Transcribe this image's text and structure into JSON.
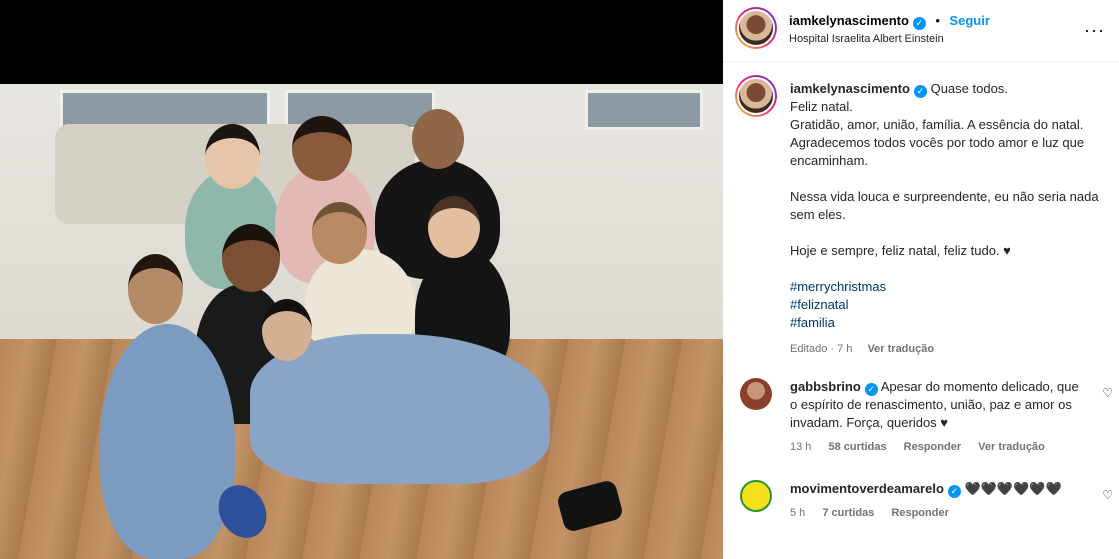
{
  "post": {
    "username": "iamkelynascimento",
    "follow_label": "Seguir",
    "separator": "•",
    "location": "Hospital Israelita Albert Einstein",
    "more_label": "···"
  },
  "caption": {
    "username": "iamkelynascimento",
    "lines": [
      "Quase todos.",
      "Feliz natal.",
      "Gratidão, amor, união, família. A essência do natal. Agradecemos todos vocês por todo amor e luz que encaminham.",
      "Nessa vida louca e surpreendente, eu não seria nada sem eles.",
      "Hoje e sempre, feliz natal, feliz tudo. ♥"
    ],
    "hashtags": [
      "#merrychristmas",
      "#feliznatal",
      "#familia"
    ],
    "edited": "Editado · 7 h",
    "translate": "Ver tradução"
  },
  "comments": [
    {
      "username": "gabbsbrino",
      "text": "Apesar do momento delicado, que o espírito de renascimento, união, paz e amor os invadam. Força, queridos ♥",
      "time": "13 h",
      "likes": "58 curtidas",
      "reply": "Responder",
      "translate": "Ver tradução"
    },
    {
      "username": "movimentoverdeamarelo",
      "text": "🖤🖤🖤🖤🖤🖤",
      "time": "5 h",
      "likes": "7 curtidas",
      "reply": "Responder"
    }
  ],
  "icons": {
    "verified": "verified-badge-icon",
    "heart": "heart-outline-icon",
    "more": "more-options-icon"
  },
  "colors": {
    "accent": "#0095f6",
    "hashtag": "#00376b",
    "muted": "#737373"
  }
}
